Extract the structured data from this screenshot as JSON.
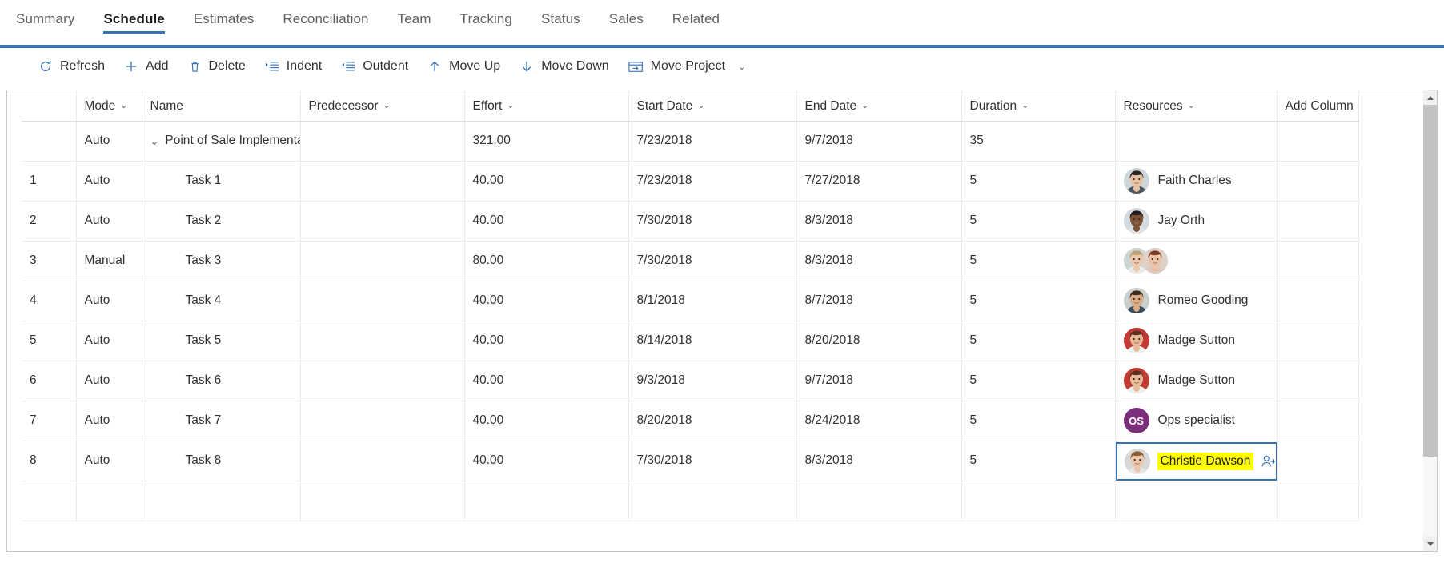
{
  "tabs": [
    {
      "label": "Summary",
      "active": false
    },
    {
      "label": "Schedule",
      "active": true
    },
    {
      "label": "Estimates",
      "active": false
    },
    {
      "label": "Reconciliation",
      "active": false
    },
    {
      "label": "Team",
      "active": false
    },
    {
      "label": "Tracking",
      "active": false
    },
    {
      "label": "Status",
      "active": false
    },
    {
      "label": "Sales",
      "active": false
    },
    {
      "label": "Related",
      "active": false
    }
  ],
  "commandbar": {
    "items": [
      {
        "label": "Refresh",
        "icon": "refresh-icon",
        "caret": false
      },
      {
        "label": "Add",
        "icon": "plus-icon",
        "caret": false
      },
      {
        "label": "Delete",
        "icon": "trash-icon",
        "caret": false
      },
      {
        "label": "Indent",
        "icon": "indent-icon",
        "caret": false
      },
      {
        "label": "Outdent",
        "icon": "outdent-icon",
        "caret": false
      },
      {
        "label": "Move Up",
        "icon": "arrow-up-icon",
        "caret": false
      },
      {
        "label": "Move Down",
        "icon": "arrow-down-icon",
        "caret": false
      },
      {
        "label": "Move Project",
        "icon": "move-project-icon",
        "caret": true
      }
    ]
  },
  "grid": {
    "columns": [
      {
        "label": "",
        "chevron": false
      },
      {
        "label": "Mode",
        "chevron": true
      },
      {
        "label": "Name",
        "chevron": false
      },
      {
        "label": "Predecessor",
        "chevron": true
      },
      {
        "label": "Effort",
        "chevron": true
      },
      {
        "label": "Start Date",
        "chevron": true
      },
      {
        "label": "End Date",
        "chevron": true
      },
      {
        "label": "Duration",
        "chevron": true
      },
      {
        "label": "Resources",
        "chevron": true
      },
      {
        "label": "Add Column",
        "chevron": true
      }
    ],
    "rows": [
      {
        "num": "",
        "mode": "Auto",
        "name": "Point of Sale Implementat",
        "summary": true,
        "predecessor": "",
        "effort": "321.00",
        "start": "7/23/2018",
        "end": "9/7/2018",
        "duration": "35",
        "resources": []
      },
      {
        "num": "1",
        "mode": "Auto",
        "name": "Task 1",
        "summary": false,
        "predecessor": "",
        "effort": "40.00",
        "start": "7/23/2018",
        "end": "7/27/2018",
        "duration": "5",
        "resources": [
          {
            "name": "Faith Charles",
            "type": "photo",
            "photo": "woman-asian"
          }
        ]
      },
      {
        "num": "2",
        "mode": "Auto",
        "name": "Task 2",
        "summary": false,
        "predecessor": "",
        "effort": "40.00",
        "start": "7/30/2018",
        "end": "8/3/2018",
        "duration": "5",
        "resources": [
          {
            "name": "Jay Orth",
            "type": "photo",
            "photo": "man-bald"
          }
        ]
      },
      {
        "num": "3",
        "mode": "Manual",
        "name": "Task 3",
        "summary": false,
        "predecessor": "",
        "effort": "80.00",
        "start": "7/30/2018",
        "end": "8/3/2018",
        "duration": "5",
        "resources": [
          {
            "name": "",
            "type": "photo",
            "photo": "woman-blonde"
          },
          {
            "name": "",
            "type": "photo",
            "photo": "woman-redhead"
          }
        ]
      },
      {
        "num": "4",
        "mode": "Auto",
        "name": "Task 4",
        "summary": false,
        "predecessor": "",
        "effort": "40.00",
        "start": "8/1/2018",
        "end": "8/7/2018",
        "duration": "5",
        "resources": [
          {
            "name": "Romeo Gooding",
            "type": "photo",
            "photo": "man-beard"
          }
        ]
      },
      {
        "num": "5",
        "mode": "Auto",
        "name": "Task 5",
        "summary": false,
        "predecessor": "",
        "effort": "40.00",
        "start": "8/14/2018",
        "end": "8/20/2018",
        "duration": "5",
        "resources": [
          {
            "name": "Madge Sutton",
            "type": "photo",
            "photo": "woman-brunette"
          }
        ]
      },
      {
        "num": "6",
        "mode": "Auto",
        "name": "Task 6",
        "summary": false,
        "predecessor": "",
        "effort": "40.00",
        "start": "9/3/2018",
        "end": "9/7/2018",
        "duration": "5",
        "resources": [
          {
            "name": "Madge Sutton",
            "type": "photo",
            "photo": "woman-brunette"
          }
        ]
      },
      {
        "num": "7",
        "mode": "Auto",
        "name": "Task 7",
        "summary": false,
        "predecessor": "",
        "effort": "40.00",
        "start": "8/20/2018",
        "end": "8/24/2018",
        "duration": "5",
        "resources": [
          {
            "name": "Ops specialist",
            "type": "initials",
            "initials": "OS"
          }
        ]
      },
      {
        "num": "8",
        "mode": "Auto",
        "name": "Task 8",
        "summary": false,
        "predecessor": "",
        "effort": "40.00",
        "start": "7/30/2018",
        "end": "8/3/2018",
        "duration": "5",
        "selected_cell": "resources",
        "resources": [
          {
            "name": "Christie Dawson",
            "type": "photo",
            "photo": "woman-longhair",
            "highlighted": true
          }
        ]
      }
    ]
  },
  "colors": {
    "accent": "#3373b5",
    "highlight": "#ffff00",
    "selection_border": "#3373b5",
    "initials_avatar_bg": "#7a2f7a",
    "grid_border": "#c8c6c4",
    "row_line": "#ebebeb"
  },
  "scrollbar": {
    "up_arrow": "scroll-up-arrow",
    "down_arrow": "scroll-down-arrow",
    "thumb": "scroll-thumb"
  }
}
